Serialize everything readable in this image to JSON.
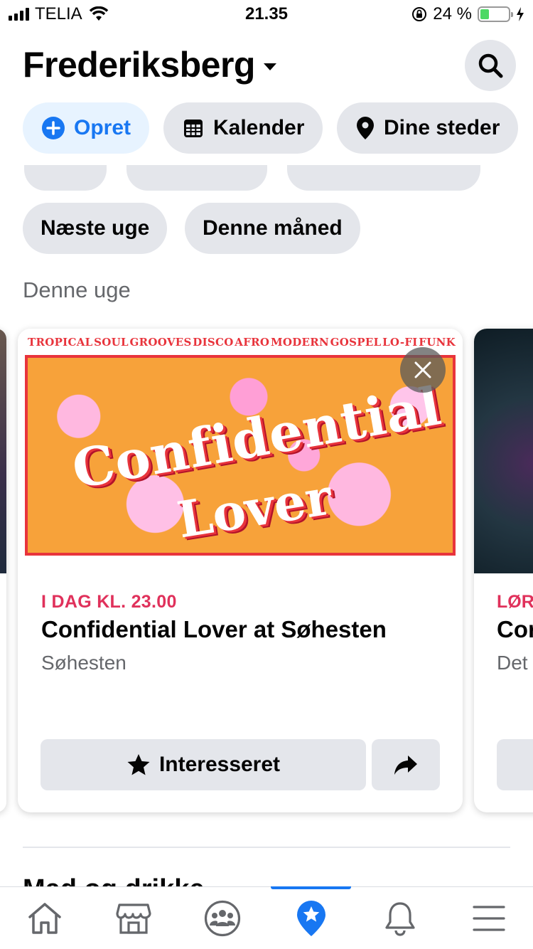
{
  "status_bar": {
    "carrier": "TELIA",
    "time": "21.35",
    "battery_percent": "24 %",
    "battery_level": 0.24
  },
  "header": {
    "location": "Frederiksberg"
  },
  "chips": {
    "create": "Opret",
    "calendar": "Kalender",
    "places": "Dine steder",
    "next_week": "Næste uge",
    "this_month": "Denne måned"
  },
  "section": {
    "label": "Denne uge"
  },
  "event_card": {
    "poster_tags": [
      "TROPICAL",
      "SOUL",
      "GROOVES",
      "DISCO",
      "AFRO",
      "MODERN",
      "GOSPEL",
      "LO-FI",
      "FUNK"
    ],
    "poster_title_line1": "Confidential",
    "poster_title_line2": "Lover",
    "date": "I DAG KL. 23.00",
    "title": "Confidential Lover at Søhesten",
    "place": "Søhesten",
    "interested_label": "Interesseret"
  },
  "next_card": {
    "date": "LØR",
    "title": "Cor",
    "place": "Det"
  },
  "next_section": {
    "label": "Mad og drikke"
  },
  "colors": {
    "accent": "#1877f2",
    "date_red": "#e0315b",
    "chip_bg": "#e4e6eb",
    "secondary_text": "#65676b"
  },
  "tabs": [
    "home-icon",
    "marketplace-icon",
    "groups-icon",
    "events-icon",
    "notifications-icon",
    "menu-icon"
  ]
}
